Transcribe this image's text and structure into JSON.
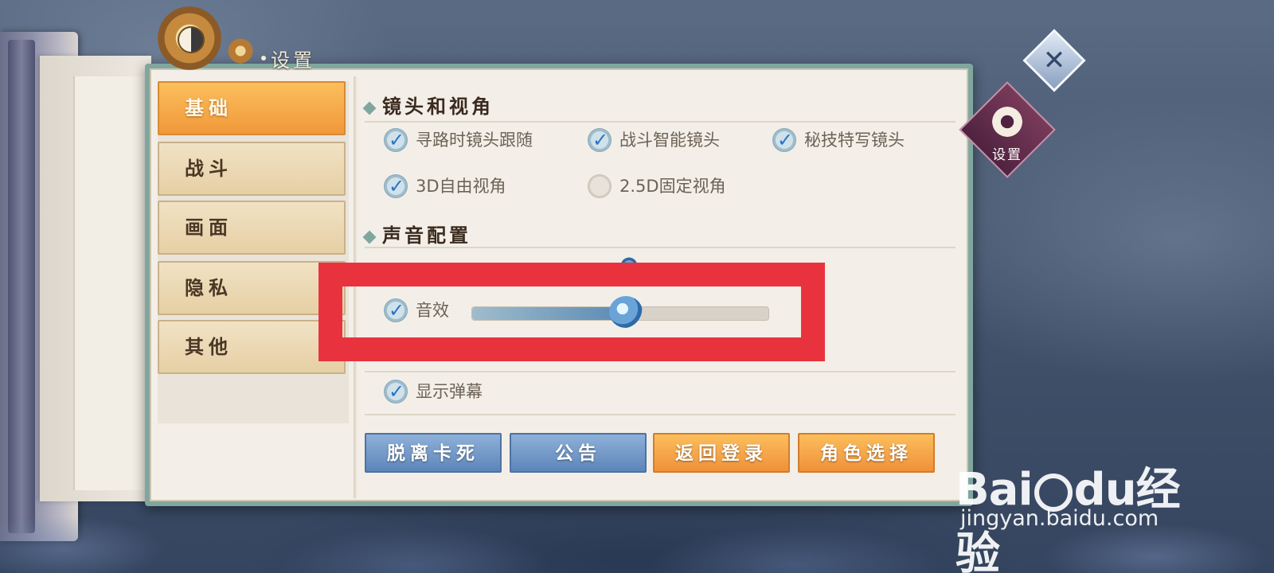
{
  "window": {
    "title": "设置"
  },
  "tabs": [
    {
      "label": "基础",
      "active": true
    },
    {
      "label": "战斗",
      "active": false
    },
    {
      "label": "画面",
      "active": false
    },
    {
      "label": "隐私",
      "active": false
    },
    {
      "label": "其他",
      "active": false
    }
  ],
  "sections": {
    "camera": {
      "title": "镜头和视角",
      "options": [
        {
          "label": "寻路时镜头跟随",
          "checked": true
        },
        {
          "label": "战斗智能镜头",
          "checked": true
        },
        {
          "label": "秘技特写镜头",
          "checked": true
        },
        {
          "label": "3D自由视角",
          "checked": true
        },
        {
          "label": "2.5D固定视角",
          "checked": false
        }
      ]
    },
    "audio": {
      "title": "声音配置",
      "sound_effect": {
        "label": "音效",
        "checked": true,
        "volume": 0.52
      },
      "danmaku": {
        "label": "显示弹幕",
        "checked": true
      }
    }
  },
  "buttons": {
    "unstuck": "脱离卡死",
    "notice": "公告",
    "return_login": "返回登录",
    "role_select": "角色选择"
  },
  "side_badge": {
    "label": "设置",
    "icon": "gear-icon"
  },
  "close": {
    "icon": "close-icon",
    "glyph": "✕"
  },
  "watermark": {
    "brand_left": "Bai",
    "brand_right": "du",
    "brand_cn": "经验",
    "url": "jingyan.baidu.com"
  },
  "colors": {
    "accent_orange": "#f1983a",
    "accent_blue": "#5d85b9",
    "highlight_red": "#e8333f",
    "frame_green": "#7fa79f"
  }
}
